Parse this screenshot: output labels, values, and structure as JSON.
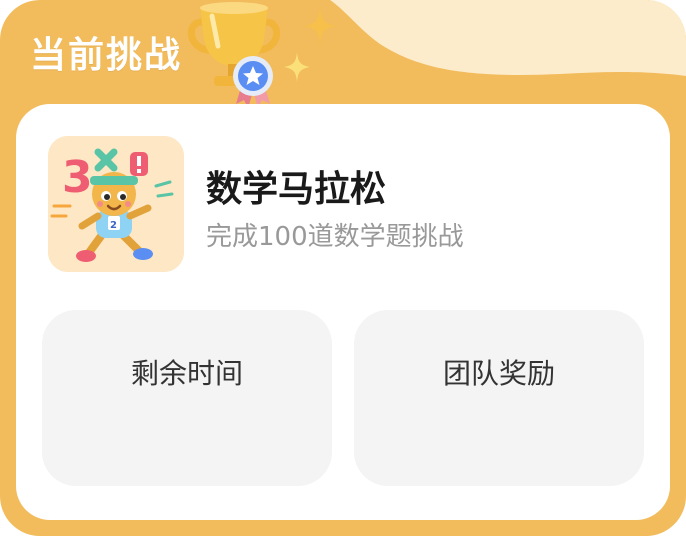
{
  "header": {
    "title": "当前挑战",
    "trophy_icon": "trophy-icon",
    "colors": {
      "outer": "#f2bb5c",
      "wave": "#fdeccb"
    }
  },
  "challenge": {
    "icon": "math-runner-icon",
    "title": "数学马拉松",
    "subtitle": "完成100道数学题挑战"
  },
  "stats": [
    {
      "label": "剩余时间"
    },
    {
      "label": "团队奖励"
    }
  ]
}
